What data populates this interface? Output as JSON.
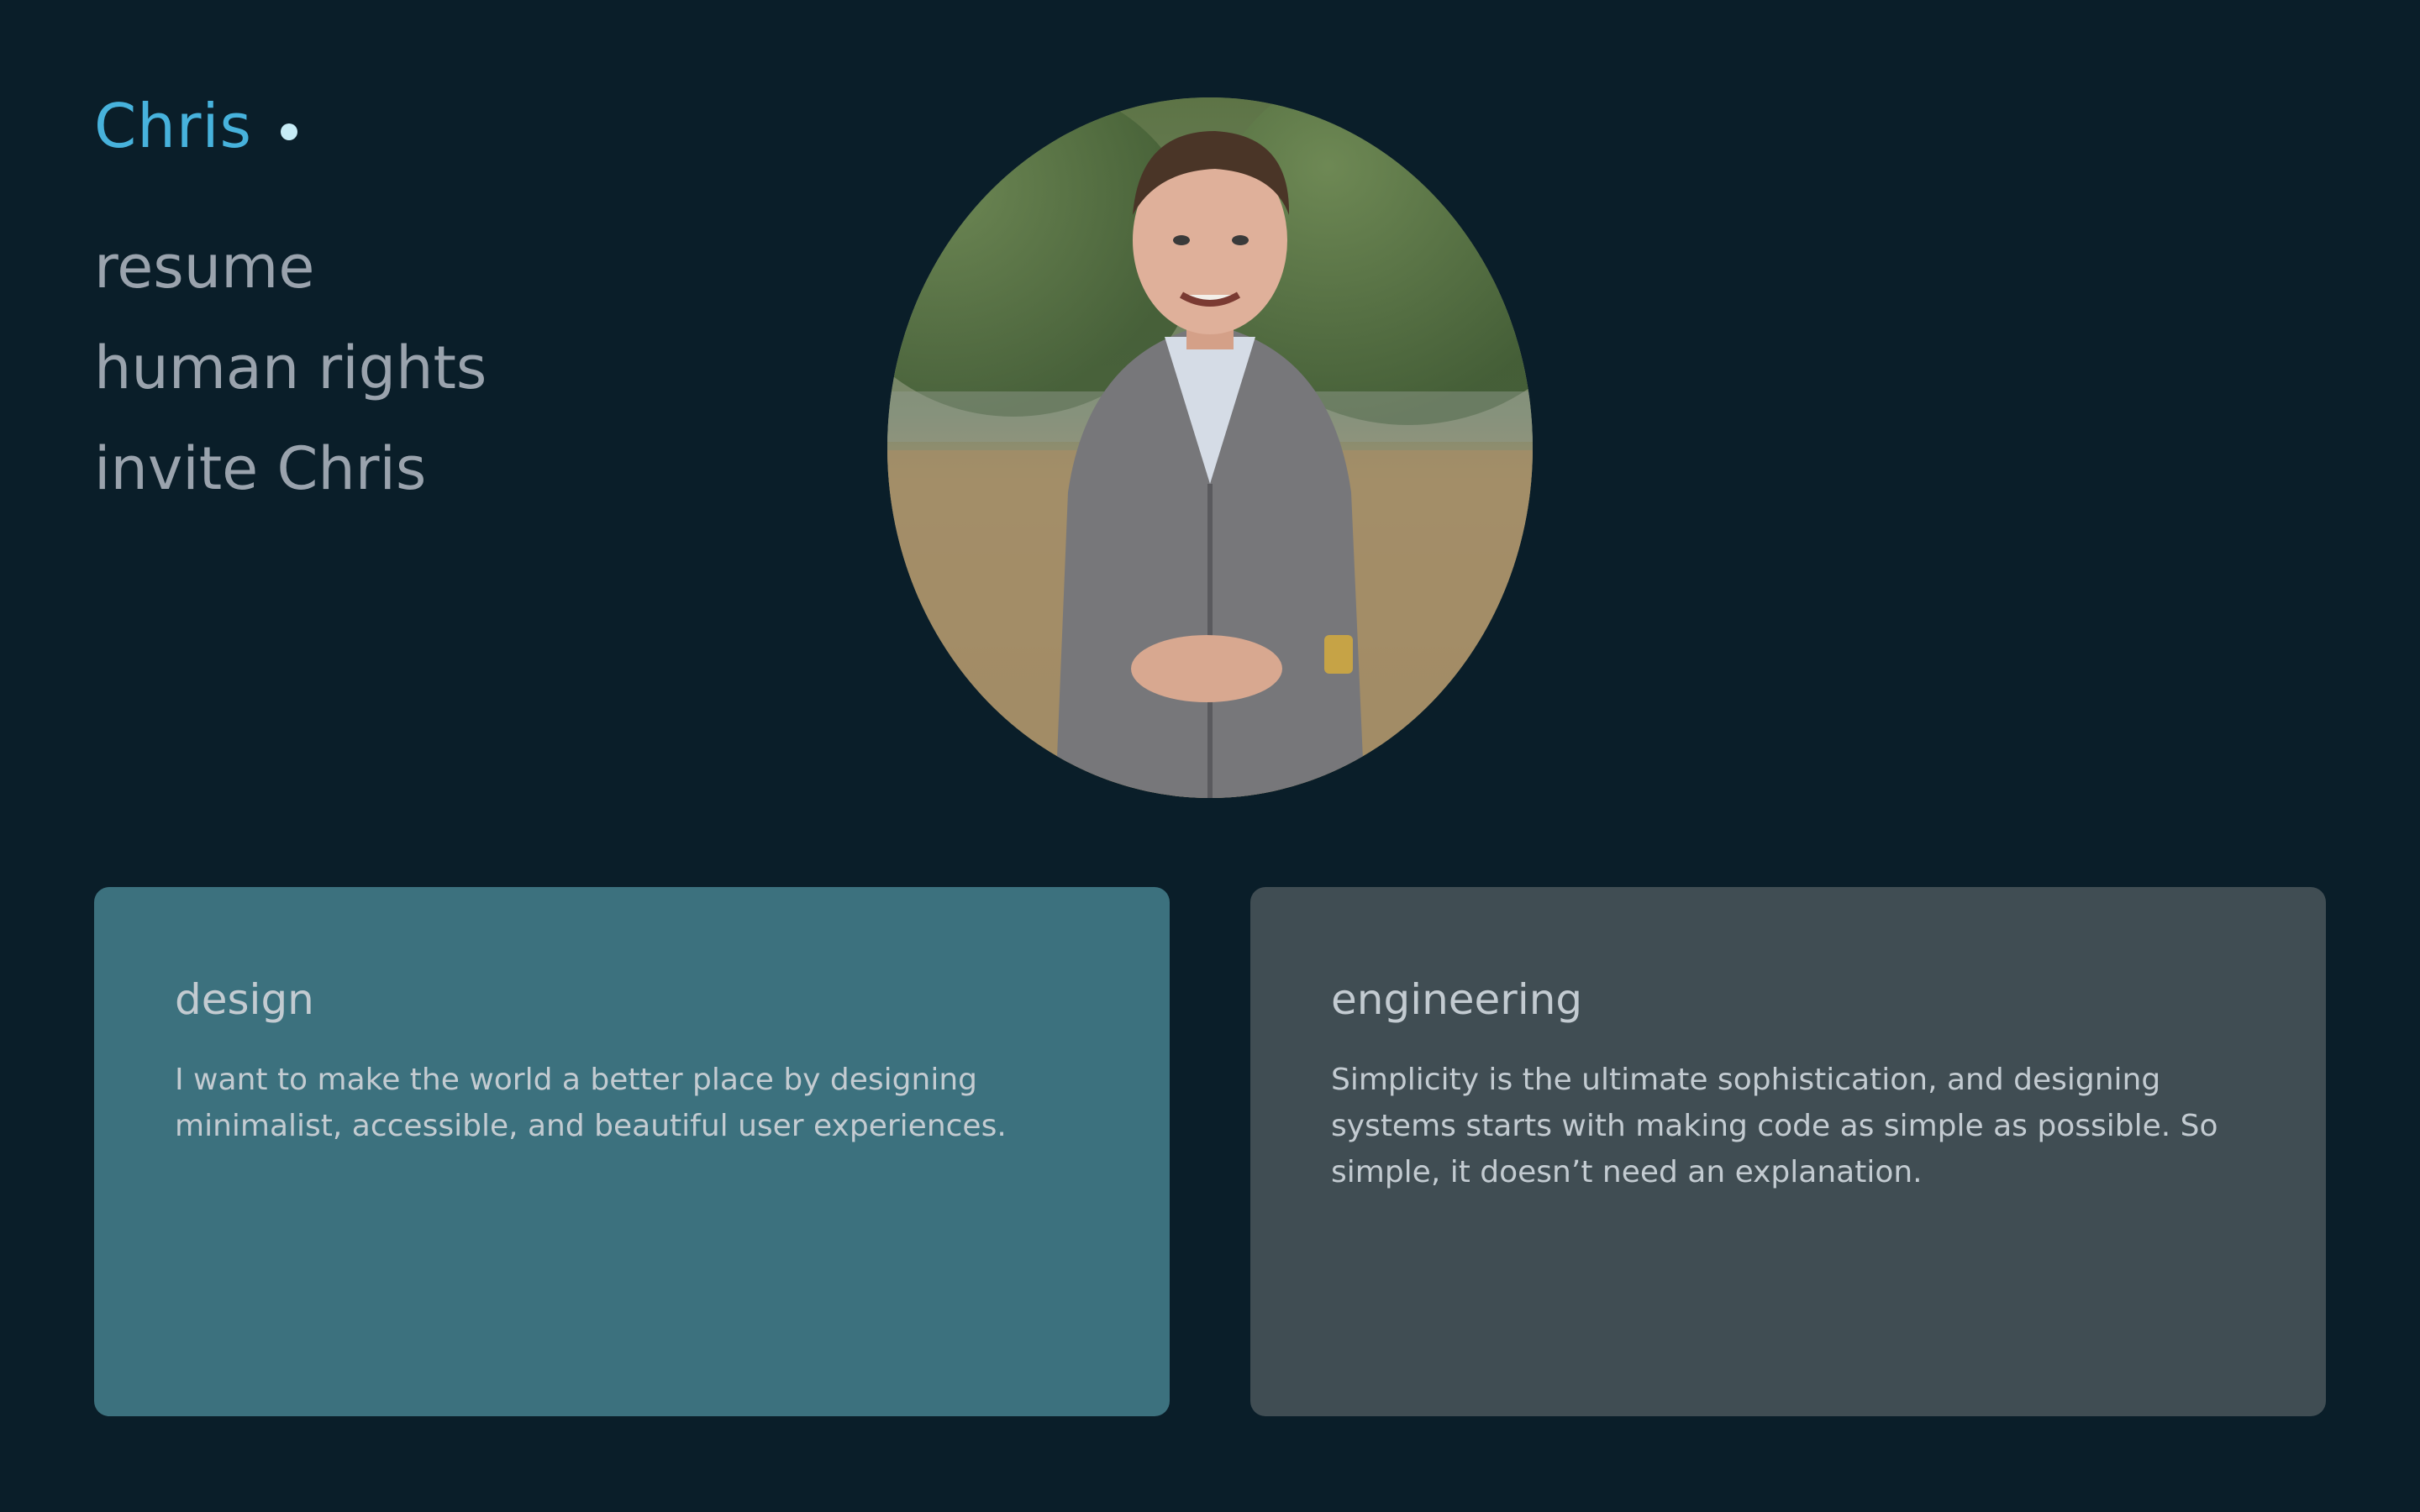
{
  "header": {
    "brand_name": "Chris"
  },
  "nav": {
    "items": [
      {
        "label": "resume"
      },
      {
        "label": "human rights"
      },
      {
        "label": "invite Chris"
      }
    ]
  },
  "hero": {
    "photo_icon": "portrait-photo"
  },
  "cards": [
    {
      "title": "design",
      "text": "I want to make the world a better place by designing minimalist, accessible, and beautiful user experiences."
    },
    {
      "title": "engineering",
      "text": "Simplicity is the ultimate sophistication, and designing systems starts with making code as simple as possible. So simple, it doesn’t need an explanation."
    }
  ],
  "colors": {
    "background": "#0a1e29",
    "brand": "#47b2dc",
    "nav_text": "#9aa3ad",
    "design_card": "#3c717e",
    "engineering_card": "#404d53"
  }
}
